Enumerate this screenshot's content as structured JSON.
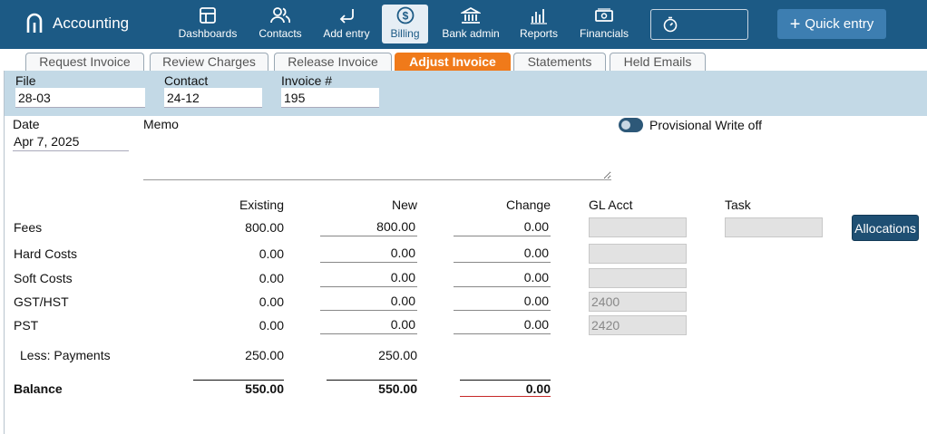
{
  "app": {
    "title": "Accounting"
  },
  "nav": [
    {
      "label": "Dashboards",
      "icon": "dashboard-icon"
    },
    {
      "label": "Contacts",
      "icon": "contacts-icon"
    },
    {
      "label": "Add entry",
      "icon": "return-arrow-icon"
    },
    {
      "label": "Billing",
      "icon": "dollar-icon",
      "active": true
    },
    {
      "label": "Bank admin",
      "icon": "bank-icon"
    },
    {
      "label": "Reports",
      "icon": "bar-chart-icon"
    },
    {
      "label": "Financials",
      "icon": "banknote-icon"
    }
  ],
  "toolbar": {
    "timer_icon": "stopwatch-icon",
    "quick_entry": "Quick entry"
  },
  "tabs": [
    {
      "label": "Request Invoice"
    },
    {
      "label": "Review Charges"
    },
    {
      "label": "Release Invoice"
    },
    {
      "label": "Adjust Invoice",
      "active": true
    },
    {
      "label": "Statements"
    },
    {
      "label": "Held Emails"
    }
  ],
  "header": {
    "file_label": "File",
    "file_value": "28-03",
    "contact_label": "Contact",
    "contact_value": "24-12",
    "invoice_label": "Invoice #",
    "invoice_value": "195"
  },
  "form": {
    "date_label": "Date",
    "date_value": "Apr 7, 2025",
    "memo_label": "Memo",
    "provisional_label": "Provisional Write off"
  },
  "table": {
    "headers": {
      "existing": "Existing",
      "new": "New",
      "change": "Change",
      "gl": "GL Acct",
      "task": "Task"
    },
    "rows": [
      {
        "label": "Fees",
        "existing": "800.00",
        "new": "800.00",
        "change": "0.00",
        "gl": ""
      },
      {
        "label": "Hard Costs",
        "existing": "0.00",
        "new": "0.00",
        "change": "0.00",
        "gl": ""
      },
      {
        "label": "Soft Costs",
        "existing": "0.00",
        "new": "0.00",
        "change": "0.00",
        "gl": ""
      },
      {
        "label": "GST/HST",
        "existing": "0.00",
        "new": "0.00",
        "change": "0.00",
        "gl": "2400"
      },
      {
        "label": "PST",
        "existing": "0.00",
        "new": "0.00",
        "change": "0.00",
        "gl": "2420"
      }
    ],
    "payments": {
      "label": "Less: Payments",
      "existing": "250.00",
      "new": "250.00"
    },
    "balance": {
      "label": "Balance",
      "existing": "550.00",
      "new": "550.00",
      "change": "0.00"
    },
    "allocations_label": "Allocations"
  },
  "colors": {
    "topbar": "#1c5a85",
    "active_tab": "#f07a1a",
    "band": "#c3d9e6",
    "alloc_button": "#1e4f73"
  }
}
